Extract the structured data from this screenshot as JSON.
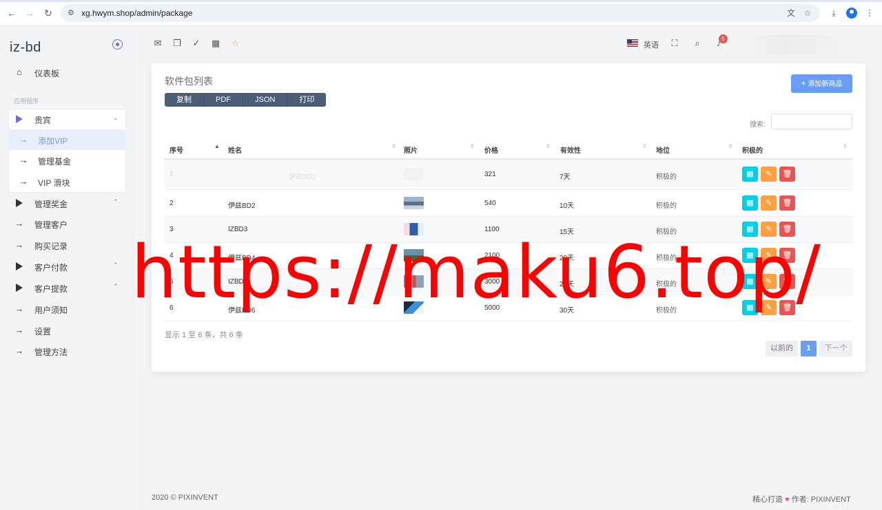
{
  "browser": {
    "url": "xg.hwym.shop/admin/package"
  },
  "sidebar": {
    "brand": "iz-bd",
    "dashboard": "仪表板",
    "section": "应用程序",
    "vip_group": "贵宾",
    "vip_items": [
      "添加VIP",
      "管理基金",
      "VIP 滑块"
    ],
    "items": [
      "管理奖金",
      "管理客户",
      "购买记录",
      "客户付款",
      "客户提款",
      "用户须知",
      "设置",
      "管理方法"
    ]
  },
  "header": {
    "language": "英语",
    "notification_count": "5"
  },
  "card": {
    "title": "软件包列表",
    "export_buttons": [
      "复制",
      "PDF",
      "JSON",
      "打印"
    ],
    "add_button": "添加新商品",
    "search_label": "搜索:"
  },
  "table": {
    "columns": [
      "序号",
      "姓名",
      "照片",
      "价格",
      "有效性",
      "地位",
      "积极的"
    ],
    "rows": [
      {
        "no": "1",
        "name": "伊兹BD1",
        "price": "321",
        "validity": "7天",
        "status": "积极的"
      },
      {
        "no": "2",
        "name": "伊兹BD2",
        "price": "540",
        "validity": "10天",
        "status": "积极的"
      },
      {
        "no": "3",
        "name": "IZBD3",
        "price": "1100",
        "validity": "15天",
        "status": "积极的"
      },
      {
        "no": "4",
        "name": "伊兹BD4",
        "price": "2100",
        "validity": "20天",
        "status": "积极的"
      },
      {
        "no": "5",
        "name": "IZBD5",
        "price": "3000",
        "validity": "25天",
        "status": "积极的"
      },
      {
        "no": "6",
        "name": "伊兹BD6",
        "price": "5000",
        "validity": "30天",
        "status": "积极的"
      }
    ],
    "info": "显示 1 至 6 条，共 6 条",
    "pager": {
      "prev": "以前的",
      "current": "1",
      "next": "下一个"
    }
  },
  "footer": {
    "copyright": "2020 © PIXINVENT",
    "made_prefix": "精心打造",
    "made_suffix": "作者:",
    "author": "PIXINVENT"
  },
  "watermark": "https://maku6.top/",
  "colors": {
    "primary": "#6b9df2",
    "view": "#00cfe8",
    "edit": "#ff9f43",
    "delete": "#ea5455",
    "export": "#4b5d74",
    "watermark": "#ff0000"
  }
}
